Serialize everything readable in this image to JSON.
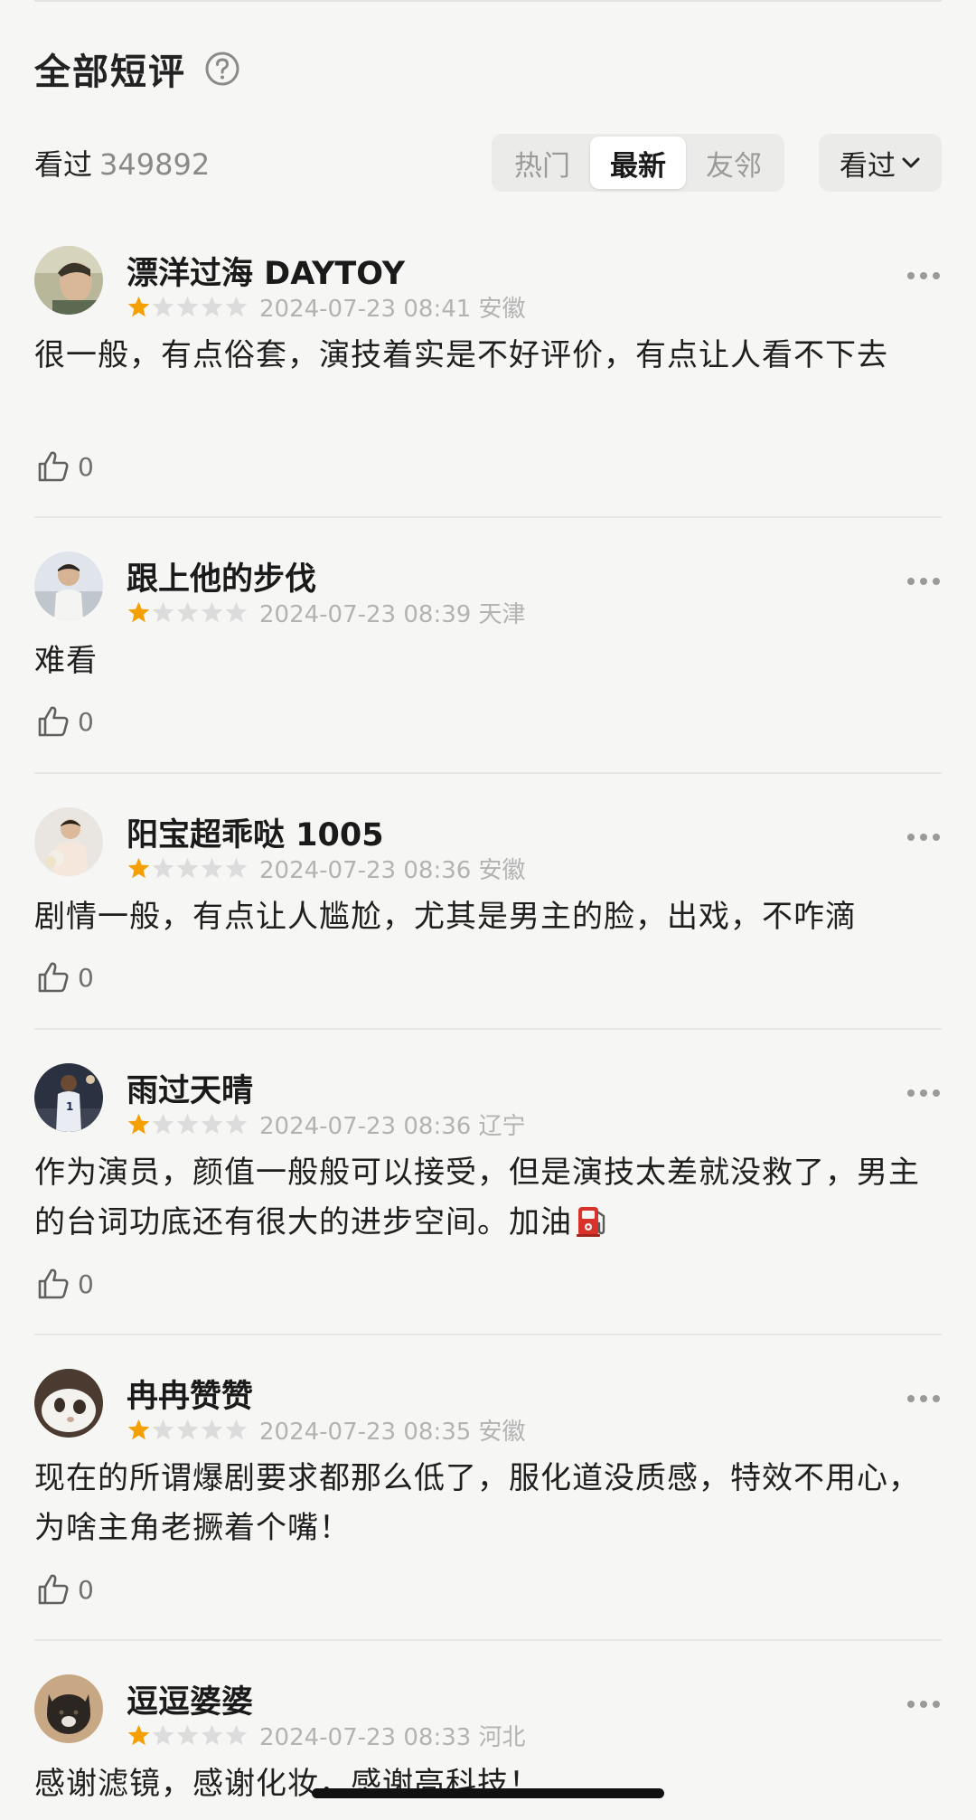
{
  "header": {
    "title": "全部短评",
    "watched_label": "看过",
    "watched_count": "349892"
  },
  "tabs": [
    {
      "label": "热门",
      "active": false
    },
    {
      "label": "最新",
      "active": true
    },
    {
      "label": "友邻",
      "active": false
    }
  ],
  "filter": {
    "label": "看过"
  },
  "colors": {
    "star_filled": "#f5a000",
    "star_empty": "#dcdcdc",
    "background": "#f6f6f4"
  },
  "reviews": [
    {
      "username": "漂洋过海 DAYTOY",
      "rating": 1,
      "time": "2024-07-23 08:41",
      "location": "安徽",
      "meta": "2024-07-23 08:41 安徽",
      "text": "很一般，有点俗套，演技着实是不好评价，有点让人看不下去",
      "likes": "0"
    },
    {
      "username": "跟上他的步伐",
      "rating": 1,
      "time": "2024-07-23 08:39",
      "location": "天津",
      "meta": "2024-07-23 08:39 天津",
      "text": "难看",
      "likes": "0"
    },
    {
      "username": "阳宝超乖哒 1005",
      "rating": 1,
      "time": "2024-07-23 08:36",
      "location": "安徽",
      "meta": "2024-07-23 08:36 安徽",
      "text": "剧情一般，有点让人尴尬，尤其是男主的脸，出戏，不咋滴",
      "likes": "0"
    },
    {
      "username": "雨过天晴",
      "rating": 1,
      "time": "2024-07-23 08:36",
      "location": "辽宁",
      "meta": "2024-07-23 08:36 辽宁",
      "text": "作为演员，颜值一般般可以接受，但是演技太差就没救了，男主的台词功底还有很大的进步空间。加油",
      "emoji": "fuel-pump-icon",
      "likes": "0"
    },
    {
      "username": "冉冉赞赞",
      "rating": 1,
      "time": "2024-07-23 08:35",
      "location": "安徽",
      "meta": "2024-07-23 08:35 安徽",
      "text": "现在的所谓爆剧要求都那么低了，服化道没质感，特效不用心，为啥主角老撅着个嘴！",
      "likes": "0"
    },
    {
      "username": "逗逗婆婆",
      "rating": 1,
      "time": "2024-07-23 08:33",
      "location": "河北",
      "meta": "2024-07-23 08:33 河北",
      "text": "感谢滤镜，感谢化妆，感谢高科技！"
    }
  ]
}
